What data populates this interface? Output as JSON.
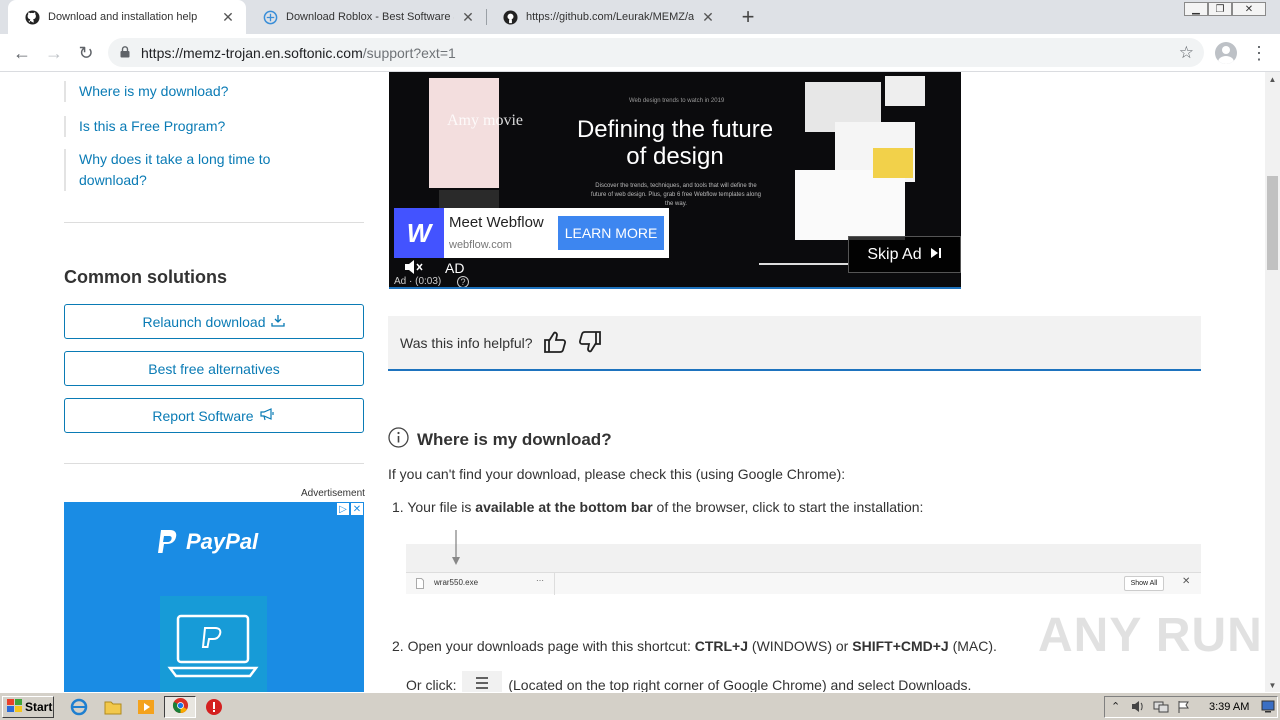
{
  "browser": {
    "tabs": [
      {
        "title": "Download and installation help",
        "active": true,
        "favicon": "github-icon"
      },
      {
        "title": "Download Roblox - Best Software &",
        "active": false,
        "favicon": "softonic-icon"
      },
      {
        "title": "https://github.com/Leurak/MEMZ/ar",
        "active": false,
        "favicon": "github-icon"
      }
    ],
    "url_host": "https://memz-trojan.en.softonic.com",
    "url_path": "/support?ext=1"
  },
  "sidebar": {
    "faq_links": [
      {
        "label": "Where is my download?"
      },
      {
        "label": "Is this a Free Program?"
      },
      {
        "label": "Why does it take a long time to download?"
      }
    ],
    "solutions_title": "Common solutions",
    "buttons": [
      {
        "label": "Relaunch download",
        "icon": "download-icon"
      },
      {
        "label": "Best free alternatives"
      },
      {
        "label": "Report Software",
        "icon": "megaphone-icon"
      }
    ],
    "ad_label": "Advertisement",
    "paypal_ad": {
      "brand": "PayPal",
      "color": "#1a8ce4"
    }
  },
  "video_ad": {
    "small_text": "Web design trends to watch in 2019",
    "headline": "Defining the future of design",
    "desc": "Discover the trends, techniques, and tools that will define the future of web design. Plus, grab 6 free Webflow templates along the way.",
    "overlay_text": "Amy movie",
    "advertiser": "Meet Webflow",
    "advertiser_url": "webflow.com",
    "cta": "LEARN MORE",
    "ad_badge": "AD",
    "timer": "Ad · (0:03)",
    "skip_label": "Skip Ad",
    "brand_color": "#4353ff"
  },
  "feedback": {
    "question": "Was this info helpful?"
  },
  "article": {
    "heading": "Where is my download?",
    "intro": "If you can't find your download, please check this (using Google Chrome):",
    "step1_pre": "1. Your file is ",
    "step1_bold": "available at the bottom bar",
    "step1_post": " of the browser, click to start the installation:",
    "download_bar": {
      "file": "wrar550.exe",
      "show_all": "Show All"
    },
    "step2_pre": "2. Open your downloads page with this shortcut: ",
    "step2_k1": "CTRL+J",
    "step2_mid": " (WINDOWS) or ",
    "step2_k2": "SHIFT+CMD+J",
    "step2_post": " (MAC).",
    "step3_pre": "Or click: ",
    "step3_post": " (Located on the top right corner of Google Chrome) and select Downloads."
  },
  "watermark": "ANY RUN",
  "taskbar": {
    "start_label": "Start",
    "clock": "3:39 AM"
  },
  "colors": {
    "link": "#0a7bb5",
    "accent_border": "#1e73be"
  }
}
